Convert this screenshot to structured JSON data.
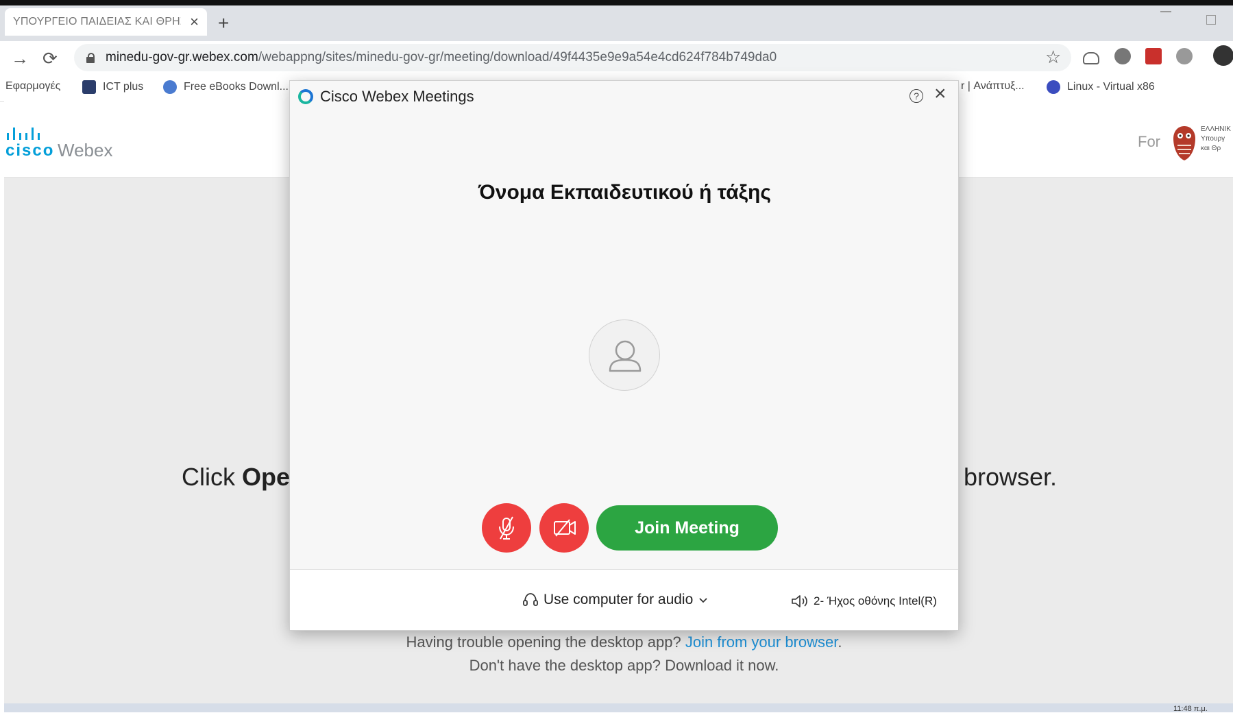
{
  "browser": {
    "tab_title": "ΥΠΟΥΡΓΕΙΟ ΠΑΙΔΕΙΑΣ ΚΑΙ ΘΡΗΣ",
    "url_host": "minedu-gov-gr.webex.com",
    "url_path": "/webappng/sites/minedu-gov-gr/meeting/download/49f4435e9e9a54e4cd624f784b749da0",
    "bookmarks": [
      "Εφαρμογές",
      "ICT plus",
      "Free eBooks Downl...",
      "r | Ανάπτυξ...",
      "Linux - Virtual x86"
    ]
  },
  "page": {
    "brand_cisco": "cisco",
    "brand_webex": "Webex",
    "for_label": "For",
    "ministry_text": "ΕΛΛΗΝΙΚ\nΥπουργ\nκαι Θρ",
    "click_prefix": "Click ",
    "click_bold": "Ope",
    "click_suffix": "browser.",
    "trouble_text": "Having trouble opening the desktop app? ",
    "trouble_link": "Join from your browser",
    "trouble_end": ".",
    "download_text": "Don't have the desktop app? Download it now.",
    "clock": "11:48 π.μ."
  },
  "dialog": {
    "title": "Cisco Webex Meetings",
    "help_glyph": "?",
    "participant_name": "Όνομα Εκπαιδευτικού ή τάξης",
    "join_label": "Join Meeting",
    "audio_option": "Use computer for audio",
    "speaker_device": "2- Ήχος οθόνης Intel(R)"
  },
  "colors": {
    "join_green": "#2ca542",
    "mute_red": "#ee3e3e",
    "link_blue": "#1e90d6",
    "cisco_blue": "#049fd9"
  },
  "icons": {
    "mic": "mic-muted-icon",
    "camera": "camera-off-icon",
    "headset": "headset-icon",
    "speaker": "speaker-icon",
    "avatar": "person-icon"
  }
}
